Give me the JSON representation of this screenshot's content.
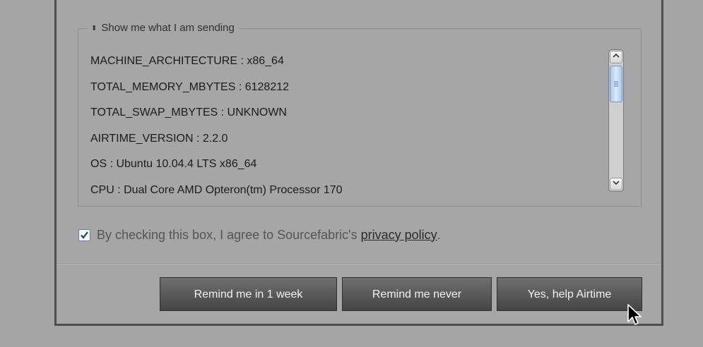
{
  "dialog": {
    "fieldset": {
      "legend_arrow": "⬍",
      "legend_label": "Show me what I am sending",
      "info_rows": [
        "MACHINE_ARCHITECTURE : x86_64",
        "TOTAL_MEMORY_MBYTES : 6128212",
        "TOTAL_SWAP_MBYTES : UNKNOWN",
        "AIRTIME_VERSION : 2.2.0",
        "OS : Ubuntu 10.04.4 LTS x86_64",
        "CPU : Dual Core AMD Opteron(tm) Processor 170"
      ]
    },
    "agreement": {
      "checked": true,
      "text_before": "By checking this box, I agree to Sourcefabric's ",
      "link_text": "privacy policy",
      "text_after": "."
    },
    "buttons": {
      "remind_week": "Remind me in 1 week",
      "remind_never": "Remind me never",
      "yes_help": "Yes, help Airtime"
    }
  }
}
